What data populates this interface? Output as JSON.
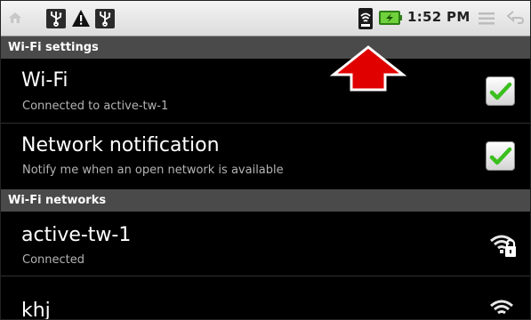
{
  "status_bar": {
    "time": "1:52 PM",
    "icons": [
      "home-icon",
      "usb-icon",
      "warning-icon",
      "usb-icon",
      "wifi-signal-icon",
      "battery-charging-icon",
      "menu-icon",
      "back-icon"
    ]
  },
  "sections": {
    "wifi_settings": "Wi-Fi settings",
    "wifi_networks": "Wi-Fi networks"
  },
  "settings": {
    "wifi": {
      "title": "Wi-Fi",
      "summary": "Connected to active-tw-1",
      "checked": true
    },
    "network_notification": {
      "title": "Network notification",
      "summary": "Notify me when an open network is available",
      "checked": true
    }
  },
  "networks": [
    {
      "ssid": "active-tw-1",
      "status": "Connected",
      "icon": "wifi-secured-icon"
    },
    {
      "ssid": "khj",
      "status": "",
      "icon": "wifi-icon"
    }
  ],
  "colors": {
    "accent_green": "#3bbf1f",
    "annotation_red": "#e00000",
    "section_header_bg": "#4a4a4a"
  }
}
